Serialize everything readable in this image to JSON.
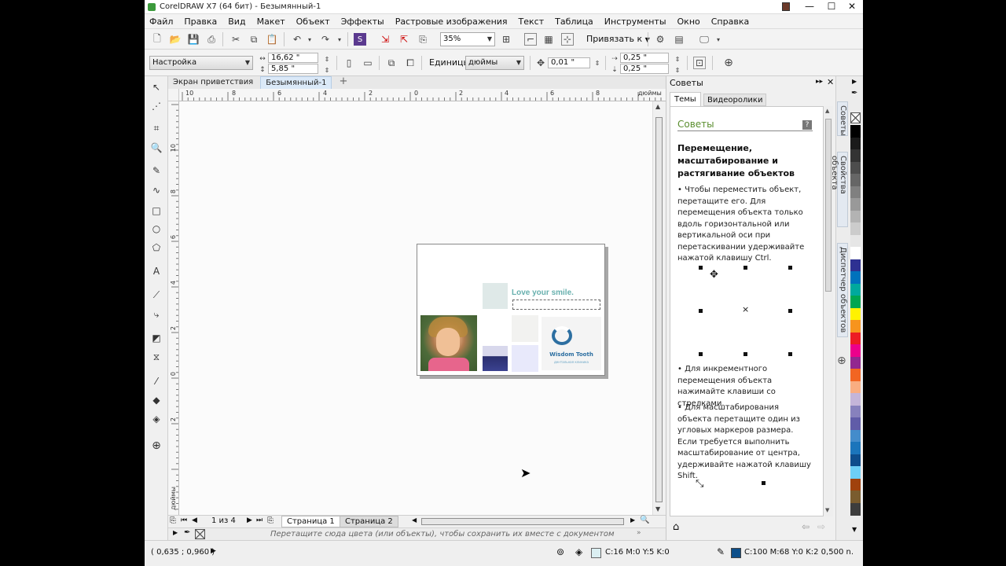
{
  "window": {
    "title": "CorelDRAW X7 (64 бит) - Безымянный-1"
  },
  "menu": [
    "Файл",
    "Правка",
    "Вид",
    "Макет",
    "Объект",
    "Эффекты",
    "Растровые изображения",
    "Текст",
    "Таблица",
    "Инструменты",
    "Окно",
    "Справка"
  ],
  "standard_toolbar": {
    "zoom": "35%",
    "snap_label": "Привязать к"
  },
  "property_bar": {
    "preset": "Настройка",
    "width": "16,62 \"",
    "height": "5,85 \"",
    "units_label": "Единицы:",
    "units_value": "дюймы",
    "nudge": "0,01 \"",
    "dup_x": "0,25 \"",
    "dup_y": "0,25 \""
  },
  "doc_tabs": [
    "Экран приветствия",
    "Безымянный-1"
  ],
  "ruler": {
    "h_ticks": [
      "10",
      "8",
      "6",
      "4",
      "2",
      "0",
      "2",
      "4",
      "6",
      "8"
    ],
    "h_unit": "дюймы",
    "v_ticks": [
      "12",
      "10",
      "8",
      "6",
      "4",
      "2",
      "0",
      "2"
    ],
    "v_unit": "дюймы"
  },
  "page_nav": {
    "counter": "1 из 4",
    "pages": [
      "Страница 1",
      "Страница 2"
    ]
  },
  "palette_hint": "Перетащите сюда цвета (или объекты), чтобы сохранить их вместе с документом",
  "status": {
    "coords": "( 0,635 ; 0,960 )",
    "fill": "C:16 M:0 Y:5 K:0",
    "outline": "C:100 M:68 Y:0 K:2  0,500 n.",
    "fill_color": "#dbeff2",
    "outline_color": "#0d4f8a"
  },
  "design": {
    "headline": "Love your smile.",
    "logo_name": "Wisdom Tooth",
    "logo_tagline": "дентальная клиника"
  },
  "docker": {
    "title": "Советы",
    "tabs": [
      "Темы",
      "Видеоролики"
    ],
    "section": "Советы",
    "heading": "Перемещение, масштабирование и растягивание объектов",
    "tip1": "• Чтобы переместить объект, перетащите его. Для перемещения объекта только вдоль горизонтальной или вертикальной оси при перетаскивании удерживайте нажатой клавишу Ctrl.",
    "tip2": "• Для инкрементного перемещения объекта нажимайте клавиши со стрелками.",
    "tip3": "• Для масштабирования объекта перетащите один из угловых маркеров размера. Если требуется выполнить масштабирование от центра, удерживайте нажатой клавишу Shift."
  },
  "docker_side_tabs": [
    "Советы",
    "Свойства объекта",
    "Диспетчер объектов"
  ],
  "palette_colors": [
    "#000000",
    "#1a1a1a",
    "#333333",
    "#4d4d4d",
    "#666666",
    "#808080",
    "#999999",
    "#b3b3b3",
    "#cccccc",
    "#e6e6e6",
    "#ffffff",
    "#2e3192",
    "#0072bc",
    "#00a99d",
    "#00a651",
    "#fff200",
    "#f7941d",
    "#ed1c24",
    "#ec008c",
    "#92278f",
    "#f26522",
    "#f9ad81",
    "#c4b5d9",
    "#8781bd",
    "#605ca8",
    "#448ccb",
    "#1b75bb",
    "#0e4d8c",
    "#6dcff6",
    "#a0410d",
    "#7a5c2e",
    "#3d3d3d"
  ]
}
